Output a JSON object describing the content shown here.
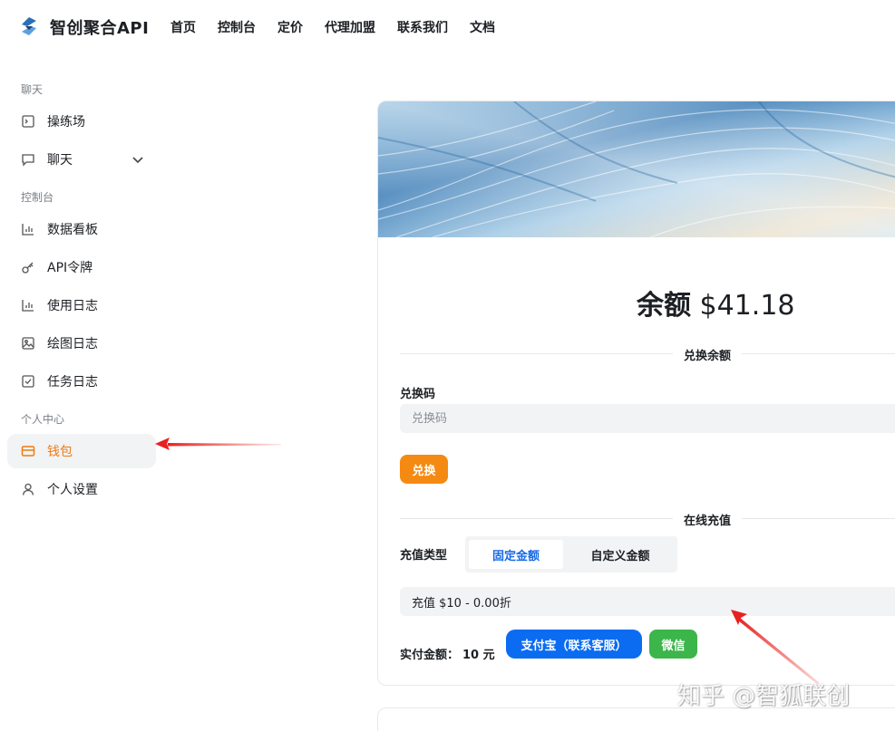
{
  "header": {
    "brand": "智创聚合API",
    "nav": [
      "首页",
      "控制台",
      "定价",
      "代理加盟",
      "联系我们",
      "文档"
    ]
  },
  "sidebar": {
    "sections": [
      {
        "title": "聊天",
        "items": [
          {
            "label": "操练场",
            "icon": "terminal-icon"
          },
          {
            "label": "聊天",
            "icon": "chat-bubble-icon",
            "expandable": true
          }
        ]
      },
      {
        "title": "控制台",
        "items": [
          {
            "label": "数据看板",
            "icon": "bar-chart-icon"
          },
          {
            "label": "API令牌",
            "icon": "key-icon"
          },
          {
            "label": "使用日志",
            "icon": "bar-chart-icon"
          },
          {
            "label": "绘图日志",
            "icon": "image-icon"
          },
          {
            "label": "任务日志",
            "icon": "checkbox-icon"
          }
        ]
      },
      {
        "title": "个人中心",
        "items": [
          {
            "label": "钱包",
            "icon": "wallet-icon",
            "active": true
          },
          {
            "label": "个人设置",
            "icon": "user-icon"
          }
        ]
      }
    ]
  },
  "wallet": {
    "balance_label": "余额",
    "balance_value": "$41.18",
    "redeem_section": "兑换余额",
    "redeem_code_label": "兑换码",
    "redeem_placeholder": "兑换码",
    "redeem_button": "兑换",
    "online_section": "在线充值",
    "topup_type_label": "充值类型",
    "topup_types": [
      "固定金额",
      "自定义金额"
    ],
    "selected_type": "固定金额",
    "package_option": "充值 $10 - 0.00折",
    "pay_label": "实付金额：",
    "pay_amount": "10 元",
    "alipay_button": "支付宝（联系客服）",
    "wechat_button": "微信"
  },
  "watermark": "知乎 @智狐联创",
  "colors": {
    "accent_orange": "#f58a12",
    "active_orange_text": "#f07a12",
    "alipay_blue": "#0b6cf2",
    "wechat_green": "#3cb54a",
    "selected_blue": "#1769e6",
    "annotation_red": "#e8201f"
  }
}
